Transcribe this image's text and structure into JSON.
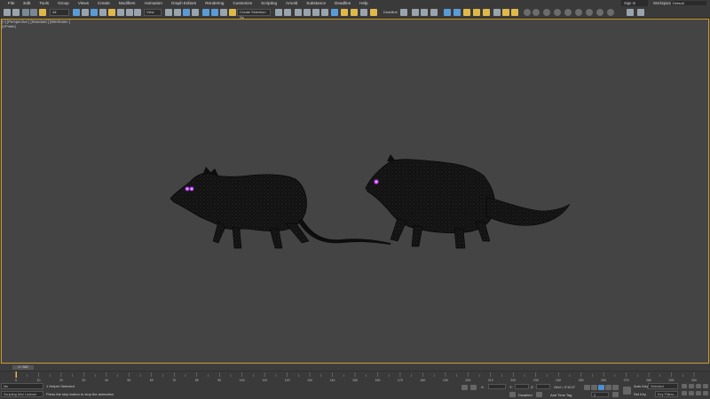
{
  "menubar": {
    "items": [
      "File",
      "Edit",
      "Tools",
      "Group",
      "Views",
      "Create",
      "Modifiers",
      "Animation",
      "Graph Editors",
      "Rendering",
      "Customize",
      "Scripting",
      "Arnold",
      "Substance",
      "Deadline",
      "Help"
    ],
    "sign_in": "Sign In",
    "workspaces_label": "Workspaces:",
    "workspace_value": "Default"
  },
  "toolbar": {
    "filter_value": "All",
    "view_value": "View",
    "selection_set": "Create Selection Se",
    "deadline": "Deadline"
  },
  "viewport": {
    "label": "[+] [Perspective ] [Standard ] [Wireframe ]",
    "sublabel": "[UPdate]"
  },
  "timeline": {
    "slider_label": "0 / 300",
    "ticks": [
      "0",
      "10",
      "20",
      "30",
      "40",
      "50",
      "60",
      "70",
      "80",
      "90",
      "100",
      "110",
      "120",
      "130",
      "140",
      "150",
      "160",
      "170",
      "180",
      "190",
      "200",
      "210",
      "220",
      "230",
      "240",
      "250",
      "260",
      "270",
      "280",
      "290",
      "300"
    ]
  },
  "status": {
    "maxscript_value": "Ms",
    "scripting_listener": "Scripting Mini Listener",
    "selected_msg": "1 Helper Selected",
    "prompt_msg": "Press the stop button to stop the animation",
    "x_label": "X:",
    "y_label": "Y:",
    "z_label": "Z:",
    "disabled_label": "Disabled",
    "grid": "Grid = 0'10.0\"",
    "add_time_tag": "Add Time Tag",
    "frame_value": "0",
    "auto_key": "Auto Key",
    "set_key": "Set Key",
    "selected_value": "Selected",
    "key_filters": "Key Filters..."
  },
  "colors": {
    "viewport_bg": "#444444",
    "ui_bg": "#3a3a3a",
    "active_border": "#c99a2a",
    "eye_glow": "#c040ff"
  }
}
